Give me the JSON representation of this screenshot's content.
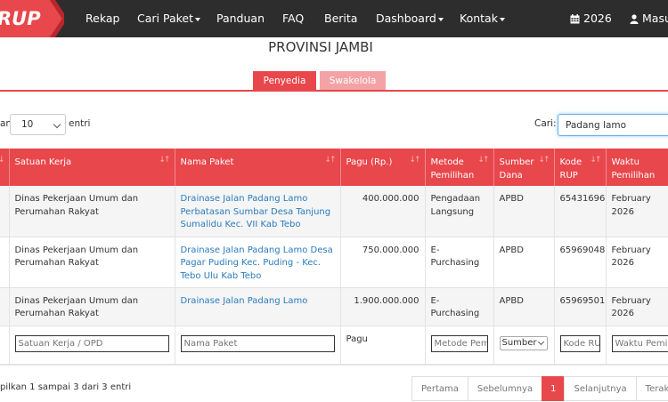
{
  "nav": {
    "logo": "RUP",
    "items": [
      "Rekap",
      "Cari Paket",
      "Panduan",
      "FAQ",
      "Berita",
      "Dashboard",
      "Kontak"
    ],
    "year": "2026",
    "login": "Masuk"
  },
  "title": "PROVINSI JAMBI",
  "tabs": {
    "active": "Penyedia",
    "inactive": "Swakelola"
  },
  "length": {
    "prefix": "an",
    "value": "10",
    "suffix": "entri"
  },
  "search": {
    "label": "Cari:",
    "value": "Padang lamo"
  },
  "table": {
    "headers": [
      "Satuan Kerja",
      "Nama Paket",
      "Pagu (Rp.)",
      "Metode Pemilihan",
      "Sumber Dana",
      "Kode RUP",
      "Waktu Pemilihan"
    ],
    "rows": [
      {
        "satker": "Dinas Pekerjaan Umum dan Perumahan Rakyat",
        "paket": "Drainase Jalan Padang Lamo Perbatasan Sumbar Desa Tanjung Sumalidu Kec. VII Kab Tebo",
        "pagu": "400.000.000",
        "metode": "Pengadaan Langsung",
        "sumber": "APBD",
        "kode": "65431696",
        "waktu": "February 2026"
      },
      {
        "satker": "Dinas Pekerjaan Umum dan Perumahan Rakyat",
        "paket": "Drainase Jalan Padang Lamo Desa Pagar Puding Kec. Puding - Kec. Tebo Ulu Kab Tebo",
        "pagu": "750.000.000",
        "metode": "E-Purchasing",
        "sumber": "APBD",
        "kode": "65969048",
        "waktu": "February 2026"
      },
      {
        "satker": "Dinas Pekerjaan Umum dan Perumahan Rakyat",
        "paket": "Drainase Jalan Padang Lamo",
        "pagu": "1.900.000.000",
        "metode": "E-Purchasing",
        "sumber": "APBD",
        "kode": "65969501",
        "waktu": "February 2026"
      }
    ],
    "filters": {
      "satker": "Satuan Kerja / OPD",
      "paket": "Nama Paket",
      "pagu": "Pagu",
      "metode": "Metode Pem",
      "sumber": "Sumber",
      "kode": "Kode RU",
      "waktu": "Waktu Pemil"
    }
  },
  "info": "pilkan 1 sampai 3 dari 3 entri",
  "pager": {
    "first": "Pertama",
    "prev": "Sebelumnya",
    "current": "1",
    "next": "Selanjutnya",
    "last": "Terakhir"
  },
  "colors": {
    "accent": "#e8474c",
    "accent_light": "#f3a3a6",
    "navbar": "#2d2d2d",
    "link": "#2a7bbd"
  }
}
